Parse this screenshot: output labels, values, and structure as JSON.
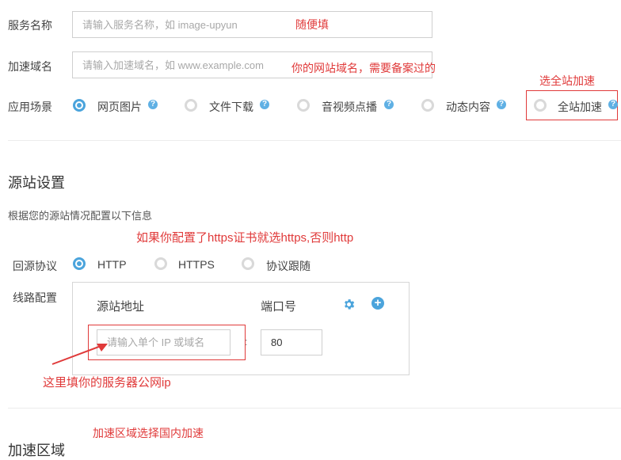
{
  "form": {
    "service_name_label": "服务名称",
    "service_name_placeholder": "请输入服务名称，如 image-upyun",
    "domain_label": "加速域名",
    "domain_placeholder": "请输入加速域名，如 www.example.com",
    "scene_label": "应用场景",
    "scenes": [
      "网页图片",
      "文件下载",
      "音视频点播",
      "动态内容",
      "全站加速"
    ]
  },
  "origin": {
    "title": "源站设置",
    "subtitle": "根据您的源站情况配置以下信息",
    "protocol_label": "回源协议",
    "protocols": [
      "HTTP",
      "HTTPS",
      "协议跟随"
    ],
    "line_label": "线路配置",
    "address_header": "源站地址",
    "port_header": "端口号",
    "address_placeholder": "请输入单个 IP 或域名",
    "port_value": "80"
  },
  "region": {
    "title": "加速区域"
  },
  "annotations": {
    "service_note": "随便填",
    "domain_note": "你的网站域名，需要备案过的",
    "scene_note": "选全站加速",
    "https_note": "如果你配置了https证书就选https,否则http",
    "ip_note": "这里填你的服务器公网ip",
    "region_note": "加速区域选择国内加速"
  },
  "colors": {
    "accent": "#4ba4dc",
    "annotation": "#e03a3a"
  }
}
